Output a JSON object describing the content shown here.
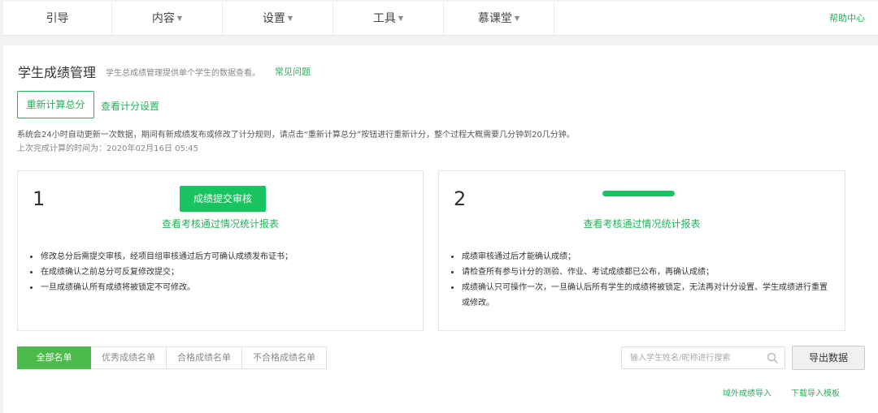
{
  "nav": {
    "items": [
      {
        "label": "引导",
        "has_dropdown": false
      },
      {
        "label": "内容",
        "has_dropdown": true
      },
      {
        "label": "设置",
        "has_dropdown": true
      },
      {
        "label": "工具",
        "has_dropdown": true
      },
      {
        "label": "慕课堂",
        "has_dropdown": true
      }
    ],
    "caret": "▼",
    "help": "帮助中心"
  },
  "header": {
    "title": "学生成绩管理",
    "description": "学生总成绩管理提供单个学生的数据查看。",
    "faq": "常见问题"
  },
  "actions": {
    "recalc": "重新计算总分",
    "view_settings": "查看计分设置"
  },
  "notice": "系统会24小时自动更新一次数据，期间有新成绩发布或修改了计分规则，请点击“重新计算总分”按钮进行重新计分，整个过程大概需要几分钟到20几分钟。",
  "last_time": "上次完成计算的时间为：2020年02月16日 05:45",
  "steps": [
    {
      "number": "1",
      "button": "成绩提交审核",
      "link": "查看考核通过情况统计报表",
      "bullets": [
        "修改总分后需提交审核，经项目组审核通过后方可确认成绩发布证书；",
        "在成绩确认之前总分可反复修改提交；",
        "一旦成绩确认所有成绩将被锁定不可修改。"
      ]
    },
    {
      "number": "2",
      "link": "查看考核通过情况统计报表",
      "bullets": [
        "成绩审核通过后才能确认成绩；",
        "请检查所有参与计分的测验、作业、考试成绩都已公布，再确认成绩；",
        "成绩确认只可操作一次，一旦确认后所有学生的成绩将被锁定，无法再对计分设置、学生成绩进行重置或修改。"
      ]
    }
  ],
  "tabs": [
    {
      "label": "全部名单",
      "active": true
    },
    {
      "label": "优秀成绩名单",
      "active": false
    },
    {
      "label": "合格成绩名单",
      "active": false
    },
    {
      "label": "不合格成绩名单",
      "active": false
    }
  ],
  "search": {
    "placeholder": "输入学生姓名/昵称进行搜索",
    "value": ""
  },
  "export": "导出数据",
  "links": {
    "import": "域外成绩导入",
    "template": "下载导入模板"
  },
  "colors": {
    "accent": "#21b35a",
    "button_green": "#19c35f",
    "tab_active": "#4cbb4c"
  }
}
